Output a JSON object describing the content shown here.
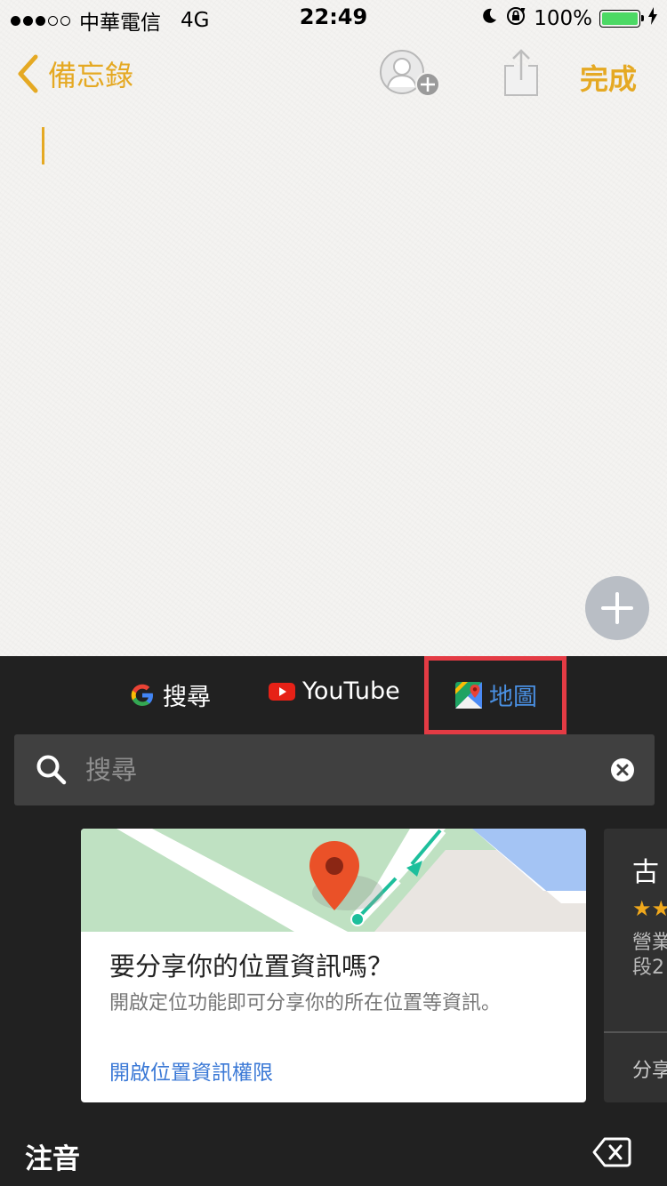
{
  "status_bar": {
    "carrier": "中華電信",
    "network": "4G",
    "time": "22:49",
    "battery_percent": "100%",
    "battery_level": 1.0,
    "signal_bars_filled": 3,
    "signal_bars_total": 5,
    "icons": [
      "moon-icon",
      "rotation-lock-icon",
      "battery-icon",
      "charging-bolt-icon"
    ]
  },
  "nav": {
    "back_label": "備忘錄",
    "done_label": "完成",
    "accent_color": "#e5a923",
    "icons": [
      "chevron-left-icon",
      "add-person-icon",
      "share-icon"
    ]
  },
  "keyboard_panel": {
    "tabs": [
      {
        "label": "搜尋",
        "icon": "google-icon"
      },
      {
        "label": "YouTube",
        "icon": "youtube-icon"
      },
      {
        "label": "地圖",
        "icon": "google-maps-icon",
        "selected": true
      }
    ],
    "highlight_color": "#e43b44",
    "search": {
      "placeholder": "搜尋",
      "value": ""
    },
    "location_card": {
      "title": "要分享你的位置資訊嗎？",
      "subtitle": "開啟定位功能即可分享你的所在位置等資訊。",
      "link": "開啟位置資訊權限"
    },
    "next_card": {
      "title": "古",
      "stars": "★★",
      "line1": "營業",
      "line2": "段2",
      "share": "分享"
    },
    "ime_label": "注音"
  }
}
